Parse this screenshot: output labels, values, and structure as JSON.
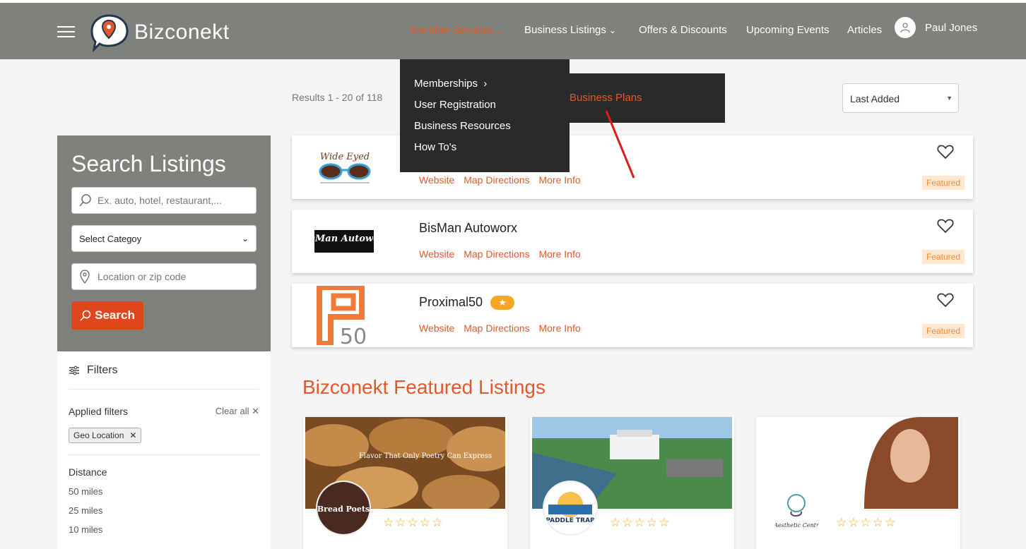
{
  "header": {
    "logo_text": "Bizconekt",
    "nav": [
      {
        "label": "Member Services"
      },
      {
        "label": "Business Listings"
      },
      {
        "label": "Offers & Discounts"
      },
      {
        "label": "Upcoming Events"
      },
      {
        "label": "Articles"
      }
    ],
    "user_name": "Paul Jones"
  },
  "dropdown": {
    "items": [
      "Memberships",
      "User Registration",
      "Business Resources",
      "How To's"
    ],
    "submenu_item": "Business Plans"
  },
  "results": {
    "text": "Results 1 - 20 of 118",
    "sort_selected": "Last Added"
  },
  "sidebar": {
    "title": "Search Listings",
    "search_placeholder": "Ex. auto, hotel, restaurant,...",
    "category_selected": "Select Categoy",
    "location_placeholder": "Location or zip code",
    "search_button": "Search"
  },
  "filters": {
    "title": "Filters",
    "applied_label": "Applied filters",
    "clear_all": "Clear all",
    "chip": "Geo Location",
    "distance_title": "Distance",
    "distance_options": [
      "50 miles",
      "25 miles",
      "10 miles"
    ]
  },
  "listings": [
    {
      "name": "",
      "logo_text": "Wide Eyed",
      "links": [
        "Website",
        "Map Directions",
        "More Info"
      ],
      "badge": "Featured"
    },
    {
      "name": "BisMan Autoworx",
      "logo_text": "BisMan Autoworx",
      "links": [
        "Website",
        "Map Directions",
        "More Info"
      ],
      "badge": "Featured"
    },
    {
      "name": "Proximal50",
      "logo_text": "50",
      "links": [
        "Website",
        "Map Directions",
        "More Info"
      ],
      "badge": "Featured"
    }
  ],
  "featured": {
    "heading": "Bizconekt Featured Listings",
    "cards": [
      {
        "image_text": "Flavor That Only Poetry Can Express",
        "badge_text": "Bread Poets",
        "stars": "☆☆☆☆☆"
      },
      {
        "badge_text": "PADDLE TRAP",
        "stars": "☆☆☆☆☆"
      },
      {
        "badge_text": "Aesthetic Centr",
        "stars": "☆☆☆☆☆"
      }
    ]
  },
  "colors": {
    "accent": "#e0592c",
    "header": "#7f817c",
    "menu": "#2a2a2a",
    "star": "#f5a623"
  }
}
